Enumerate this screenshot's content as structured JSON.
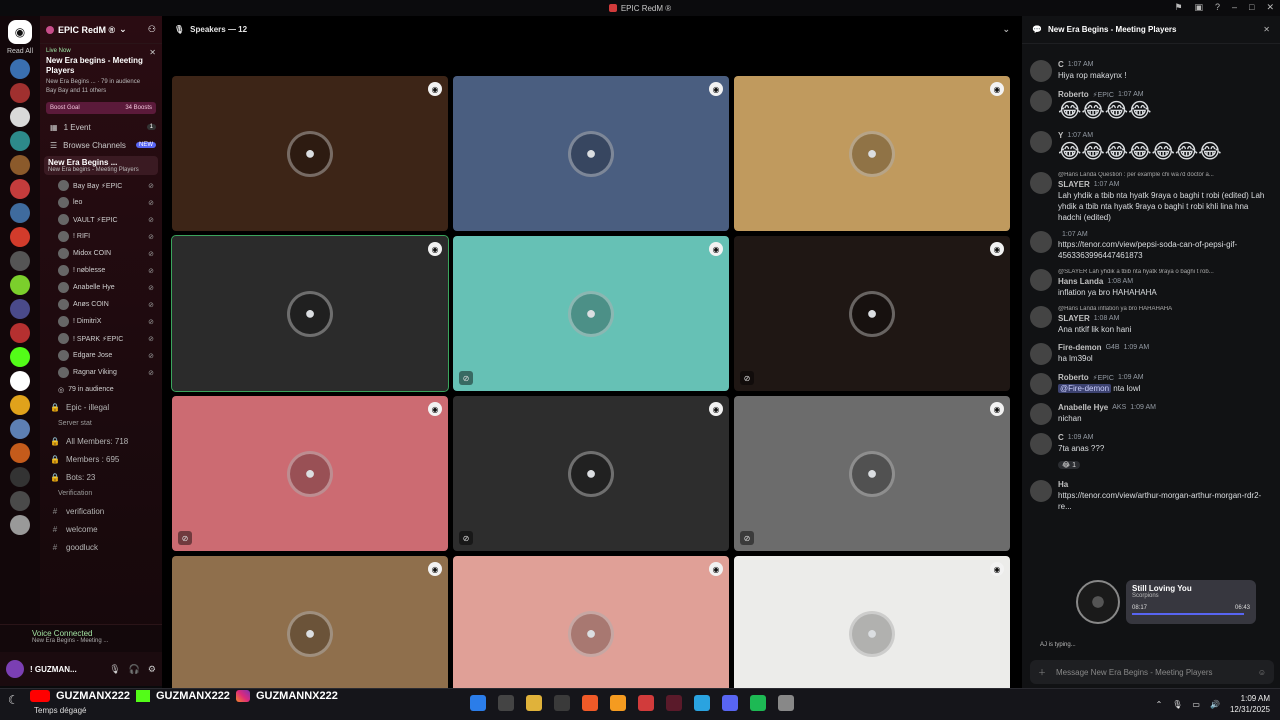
{
  "window": {
    "title": "EPIC RedM ®"
  },
  "rail": {
    "read_all": "Read All"
  },
  "server": {
    "name": "EPIC RedM ®"
  },
  "live_card": {
    "tag": "Live Now",
    "title": "New Era begins - Meeting Players",
    "sub": "New Era Begins ... · 79 in audience",
    "participants": "Bay Bay and 11 others"
  },
  "boost": {
    "label": "Boost Goal",
    "value": "34 Boosts"
  },
  "nav": {
    "events": "1 Event",
    "events_count": "1",
    "browse": "Browse Channels",
    "browse_badge": "NEW"
  },
  "voice_channel": {
    "name": "New Era Begins ...",
    "status": "New Era begins - Meeting Players"
  },
  "voice_members": [
    "Bay Bay  ⚡EPIC",
    "leo",
    "VAULT  ⚡EPIC",
    "! RIFI",
    "Midox  COIN",
    "! nøblesse",
    "Anabelle Hye",
    "Anøs  COIN",
    "! DimitriX",
    "! SPARK  ⚡EPIC",
    "Edgare Jose",
    "Ragnar Viking"
  ],
  "audience": "79 in audience",
  "channels": [
    {
      "icon": "lock",
      "name": "Epic - illegal"
    },
    {
      "icon": "cat",
      "name": "Server stat"
    },
    {
      "icon": "lock",
      "name": "All Members: 718"
    },
    {
      "icon": "lock",
      "name": "Members : 695"
    },
    {
      "icon": "lock",
      "name": "Bots: 23"
    },
    {
      "icon": "cat",
      "name": "Verification"
    },
    {
      "icon": "#",
      "name": "verification"
    },
    {
      "icon": "#",
      "name": "welcome"
    },
    {
      "icon": "#",
      "name": "goodluck"
    }
  ],
  "voice_panel": {
    "status": "Voice Connected",
    "channel": "New Era Begins - Meeting ..."
  },
  "user": {
    "name": "! GUZMAN..."
  },
  "stage": {
    "header": "Speakers — 12"
  },
  "tiles": [
    {
      "bg": "#3d2517",
      "avatar": "cowboy",
      "muted": false
    },
    {
      "bg": "#4a5e80",
      "avatar": "masked-man",
      "muted": false
    },
    {
      "bg": "#c09a5e",
      "avatar": "woman",
      "muted": false
    },
    {
      "bg": "#2b2b2b",
      "avatar": "lion-mask",
      "muted": false,
      "speaking": true
    },
    {
      "bg": "#66c1b5",
      "avatar": "anime",
      "muted": true
    },
    {
      "bg": "#1f1714",
      "avatar": "robot",
      "muted": true
    },
    {
      "bg": "#cc6b72",
      "avatar": "pirate-woman",
      "muted": true
    },
    {
      "bg": "#2d2d2d",
      "avatar": "cartoon-guy",
      "muted": true
    },
    {
      "bg": "#6c6c6c",
      "avatar": "old-man",
      "muted": true
    },
    {
      "bg": "#8f6f4c",
      "avatar": "hamster",
      "muted": false
    },
    {
      "bg": "#e0a097",
      "avatar": "girl",
      "muted": false
    },
    {
      "bg": "#ececea",
      "avatar": "soldier",
      "muted": false
    }
  ],
  "chat": {
    "title": "New Era Begins - Meeting Players",
    "messages": [
      {
        "author": "C",
        "time": "1:07 AM",
        "text": "Hiya rop makaynx !"
      },
      {
        "author": "Roberto",
        "badge": "⚡EPIC",
        "time": "1:07 AM",
        "emoji": "😂😂😂😂"
      },
      {
        "author": "Y",
        "time": "1:07 AM",
        "emoji": "😂😂😂😂😂😂😂"
      },
      {
        "reply": "@Hans Landa Question : per example chi wa7d doctor a...",
        "author": "SLAYER",
        "time": "1:07 AM",
        "text": "Lah yhdik a tbib nta hyatk 9raya o baghi t robi (edited) Lah yhdik a tbib nta hyatk 9raya o baghi t robi khli lina hna hadchi (edited)"
      },
      {
        "author": "",
        "time": "1:07 AM",
        "link": "https://tenor.com/view/pepsi-soda-can-of-pepsi-gif-4563363996447461873"
      },
      {
        "reply": "@SLAYER Lah yhdik a tbib nta hyatk 9raya o baghi t rob...",
        "author": "Hans Landa",
        "time": "1:08 AM",
        "text": "inflation ya bro HAHAHAHA"
      },
      {
        "reply": "@Hans Landa inflation ya bro HAHAHAHA",
        "author": "SLAYER",
        "time": "1:08 AM",
        "text": "Ana ntklf lik kon hani"
      },
      {
        "author": "Fire-demon",
        "badge": "G4B",
        "time": "1:09 AM",
        "text": "ha lm39ol"
      },
      {
        "author": "Roberto",
        "badge": "⚡EPIC",
        "time": "1:09 AM",
        "mention": "@Fire-demon",
        "text": " nta lowl"
      },
      {
        "author": "Anabelle Hye",
        "badge": "AKS",
        "time": "1:09 AM",
        "text": "nichan"
      },
      {
        "author": "C",
        "time": "1:09 AM",
        "text": "7ta anas ???",
        "reaction": "😂 1"
      },
      {
        "author": "Ha",
        "time": "",
        "link": "https://tenor.com/view/arthur-morgan-arthur-morgan-rdr2-re..."
      }
    ],
    "typing": "AJ is typing...",
    "composer_placeholder": "Message New Era Begins - Meeting Players"
  },
  "now_playing": {
    "song": "Still Loving You",
    "artist": "Scorpions",
    "elapsed": "08:17",
    "duration": "06:43",
    "progress": 0.95
  },
  "taskbar": {
    "social": [
      "GUZMANX222",
      "GUZMANX222",
      "GUZMANNX222"
    ],
    "weather": "Temps dégagé",
    "time": "1:09 AM",
    "date": "12/31/2025"
  }
}
